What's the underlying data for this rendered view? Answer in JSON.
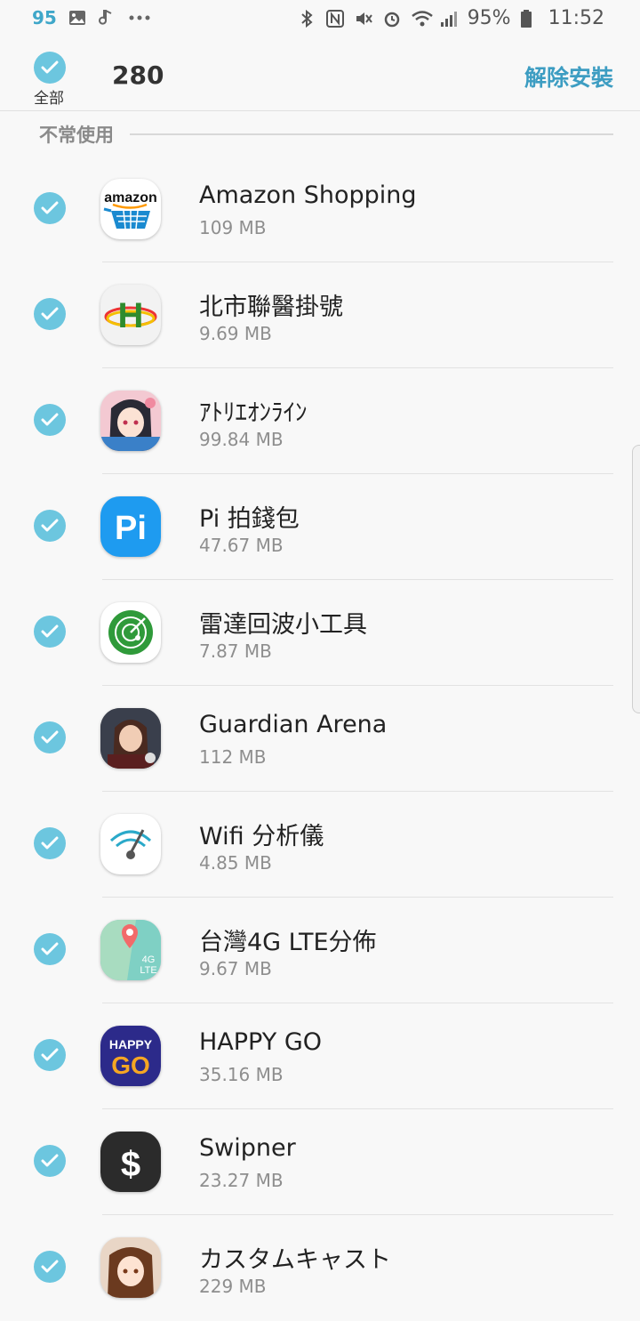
{
  "status_bar": {
    "left_number": "95",
    "battery": "95%",
    "time": "11:52",
    "icons_left": [
      "gallery-icon",
      "music-icon",
      "more-icon"
    ],
    "icons_right": [
      "bluetooth-icon",
      "nfc-icon",
      "mute-icon",
      "alarm-icon",
      "wifi-icon",
      "signal-icon",
      "battery-icon"
    ]
  },
  "header": {
    "select_all_label": "全部",
    "count": "280",
    "uninstall_label": "解除安裝"
  },
  "section": {
    "title": "不常使用"
  },
  "apps": [
    {
      "name": "Amazon Shopping",
      "size": "109 MB",
      "icon": "amazon-icon"
    },
    {
      "name": "北市聯醫掛號",
      "size": "9.69 MB",
      "icon": "hospital-h-icon"
    },
    {
      "name": "ｱﾄﾘｴｵﾝﾗｲﾝ",
      "size": "99.84 MB",
      "icon": "anime-girl-icon"
    },
    {
      "name": "Pi 拍錢包",
      "size": "47.67 MB",
      "icon": "pi-wallet-icon"
    },
    {
      "name": "雷達回波小工具",
      "size": "7.87 MB",
      "icon": "radar-icon"
    },
    {
      "name": "Guardian Arena",
      "size": "112 MB",
      "icon": "warrior-icon"
    },
    {
      "name": "Wifi 分析儀",
      "size": "4.85 MB",
      "icon": "wifi-analyzer-icon"
    },
    {
      "name": "台灣4G LTE分佈",
      "size": "9.67 MB",
      "icon": "lte-map-icon"
    },
    {
      "name": "HAPPY GO",
      "size": "35.16 MB",
      "icon": "happy-go-icon"
    },
    {
      "name": "Swipner",
      "size": "23.27 MB",
      "icon": "dollar-icon"
    },
    {
      "name": "カスタムキャスト",
      "size": "229 MB",
      "icon": "custom-cast-icon"
    }
  ],
  "colors": {
    "accent": "#3d9dc2",
    "check": "#6cc6df",
    "background": "#f8f8f8"
  }
}
